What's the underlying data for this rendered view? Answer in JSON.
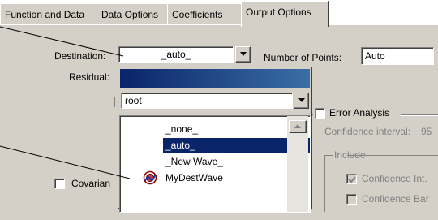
{
  "tabs": [
    {
      "label": "Function and Data"
    },
    {
      "label": "Data Options"
    },
    {
      "label": "Coefficients"
    },
    {
      "label": "Output Options",
      "active": true
    }
  ],
  "destination": {
    "label": "Destination:",
    "value": "_auto_"
  },
  "number_of_points": {
    "label": "Number of Points:",
    "value": "Auto"
  },
  "residual": {
    "label": "Residual:"
  },
  "wave_popup": {
    "folder_value": "root",
    "items": [
      {
        "label": "_none_",
        "selected": false
      },
      {
        "label": "_auto_",
        "selected": true
      },
      {
        "label": "_New Wave_",
        "selected": false
      },
      {
        "label": "MyDestWave",
        "selected": false,
        "icon": "wave-icon"
      }
    ]
  },
  "covariance": {
    "label": "Covarian"
  },
  "error_analysis": {
    "label": "Error Analysis",
    "confidence_interval_label": "Confidence interval:",
    "confidence_interval_value": "95",
    "include_label": "Include:",
    "confidence_int_label": "Confidence Int.",
    "confidence_band_label": "Confidence Bar"
  },
  "colors": {
    "title_bar_blue": "#0a246a",
    "selection": "#0a246a",
    "face": "#d4d0c8"
  }
}
